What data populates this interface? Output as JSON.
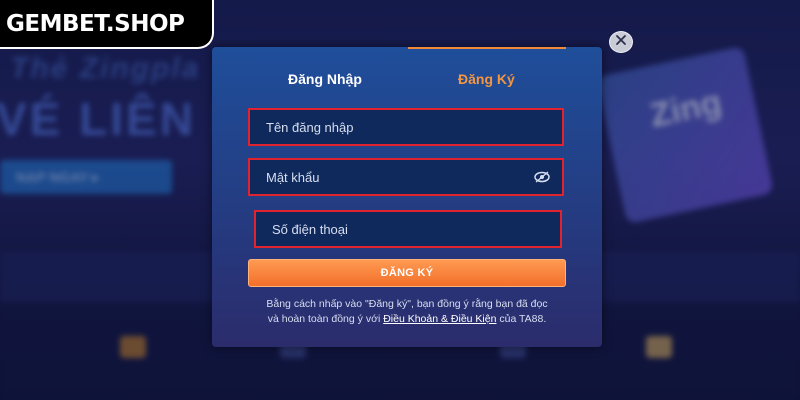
{
  "logo": {
    "text": "GEMBET.SHOP"
  },
  "background": {
    "headline_line1": "Thẻ Zingpla",
    "headline_line2": "VÉ LIÊN N",
    "button_label": "NẠP NGAY ▸",
    "card_logo": "Zing"
  },
  "modal": {
    "tabs": [
      {
        "label": "Đăng Nhập",
        "active": false
      },
      {
        "label": "Đăng Ký",
        "active": true
      }
    ],
    "fields": {
      "username": {
        "placeholder": "Tên đăng nhập"
      },
      "password": {
        "placeholder": "Mật khẩu",
        "icon": "eye-icon"
      },
      "phone": {
        "placeholder": "Số điện thoại"
      }
    },
    "submit_label": "ĐĂNG KÝ",
    "terms": {
      "line1": "Bằng cách nhấp vào \"Đăng ký\", bạn đồng ý rằng bạn đã đọc",
      "line2_prefix": "và hoàn toàn đồng ý với ",
      "link": "Điều Khoản & Điều Kiện",
      "line2_suffix": " của TA88."
    },
    "close_icon": "close-icon"
  },
  "colors": {
    "accent_orange": "#f39642",
    "field_border_red": "#e0232e",
    "modal_top": "#1f4e9a",
    "modal_bottom": "#2b2c6c"
  }
}
